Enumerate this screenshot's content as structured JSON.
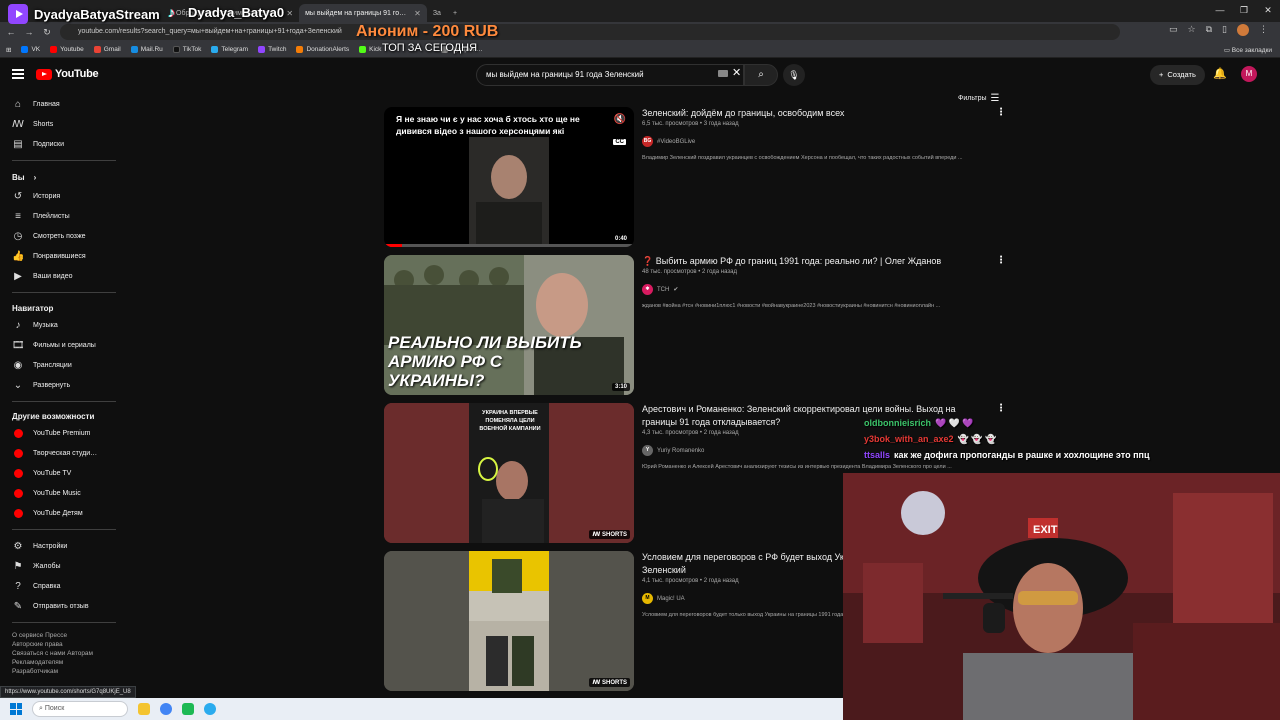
{
  "browser": {
    "tabs": [
      {
        "label": "Обращение Владимира Зеле…",
        "active": false
      },
      {
        "label": "мы выйдем на границы 91 го…",
        "active": true
      },
      {
        "label": "За",
        "active": false
      }
    ],
    "url": "youtube.com/results?search_query=мы+выйдем+на+границы+91+года+Зеленский",
    "bookmarks": [
      {
        "label": "VK",
        "color": "#0077ff"
      },
      {
        "label": "Youtube",
        "color": "#ff0000"
      },
      {
        "label": "Gmail",
        "color": "#ea4335"
      },
      {
        "label": "Mail.Ru",
        "color": "#168de2"
      },
      {
        "label": "TikTok",
        "color": "#111111"
      },
      {
        "label": "Telegram",
        "color": "#2aabee"
      },
      {
        "label": "Twitch",
        "color": "#9146ff"
      },
      {
        "label": "DonationAlerts",
        "color": "#f57d07"
      },
      {
        "label": "Kick",
        "color": "#53fc18"
      },
      {
        "label": "Аукцион…",
        "color": "#888888"
      }
    ],
    "all_bookmarks": "Все закладки",
    "status_url": "https://www.youtube.com/shorts/G7q8UKjE_U8"
  },
  "youtube": {
    "logo": "YouTube",
    "search_query": "мы выйдем на границы 91 года Зеленский",
    "create_label": "Создать",
    "avatar_letter": "M",
    "filters_label": "Фильтры"
  },
  "sidebar": {
    "main": [
      "Главная",
      "Shorts",
      "Подписки"
    ],
    "you_header": "Вы",
    "you": [
      "История",
      "Плейлисты",
      "Смотреть позже",
      "Понравившиеся",
      "Ваши видео"
    ],
    "nav_header": "Навигатор",
    "nav": [
      "Музыка",
      "Фильмы и сериалы",
      "Трансляции",
      "Развернуть"
    ],
    "more_header": "Другие возможности",
    "more": [
      "YouTube Premium",
      "Творческая студи…",
      "YouTube TV",
      "YouTube Music",
      "YouTube Детям"
    ],
    "settings": [
      "Настройки",
      "Жалобы",
      "Справка",
      "Отправить отзыв"
    ],
    "footer": [
      "О сервисе  Прессе",
      "Авторские права",
      "Связаться с нами  Авторам",
      "Рекламодателям",
      "Разработчикам"
    ]
  },
  "results": [
    {
      "title": "Зеленский: дойдём до границы, освободим всех",
      "meta": "6,5 тыс. просмотров • 3 года назад",
      "channel": "#VideoBGLive",
      "channel_icon_text": "BG",
      "channel_icon_color": "#c62828",
      "description": "Владимир Зеленский поздравил украинцев с освобождением Херсона и пообещал, что таких радостных событий впереди ...",
      "badge": "0:40",
      "subtitle_overlay": "Я не знаю чи є у нас хоча б хтось хто ще не дивився відео з нашого херсонцями які"
    },
    {
      "title": "Выбить армию РФ до границ 1991 года: реально ли? | Олег Жданов",
      "title_prefix": "❓",
      "meta": "48 тыс. просмотров • 2 года назад",
      "channel": "TCH",
      "channel_icon_text": "✱",
      "channel_icon_color": "#d81b60",
      "description": "жданов #война #тсн #новини1плюс1 #новости #войнавукраине2023 #новостиукраины #новинитсн #новиниonлайн ...",
      "badge": "3:10",
      "thumb_text": "РЕАЛЬНО ЛИ ВЫБИТЬ АРМИЮ РФ С УКРАИНЫ?"
    },
    {
      "title": "Арестович и Романенко: Зеленский скорректировал цели войны. Выход на границы 91 года откладывается?",
      "meta": "4,3 тыс. просмотров • 2 года назад",
      "channel": "Yuriy Romanenko",
      "channel_icon_text": "Y",
      "channel_icon_color": "#666666",
      "description": "Юрий Романенко и Алексей Арестович анализируют тезисы из интервью президента Владимира Зеленского про цели ...",
      "badge": "SHORTS",
      "thumb_text": "УКРАИНА ВПЕРВЫЕ ПОМЕНЯЛА ЦЕЛИ ВОЕННОЙ КАМПАНИИ"
    },
    {
      "title": "Условием для переговоров с РФ будет выход Украины на границы 1991 года – Зеленский",
      "meta": "4,1 тыс. просмотров • 2 года назад",
      "channel": "Magic! UA",
      "channel_icon_text": "M",
      "channel_icon_color": "#e6b800",
      "description": "Условием для переговоров будет только выход Украины на границы 1991 года...",
      "badge": "SHORTS"
    }
  ],
  "overlay": {
    "channel_name": "DyadyaBatyaStream",
    "tiktok_name": "Dyadya_Batya0",
    "donation": "Аноним - 200 RUB",
    "top_today": "ТОП ЗА СЕГОДНЯ",
    "chat": [
      {
        "user": "oldbonnieisrich",
        "color": "#3cc46a",
        "message": "💜 🤍 💜"
      },
      {
        "user": "y3bok_with_an_axe2",
        "color": "#e53935",
        "message": "👻 👻 👻"
      },
      {
        "user": "ttsalls",
        "color": "#9146ff",
        "message": "как же дофига пропоганды в рашке и хохлощине это ппц"
      }
    ]
  },
  "taskbar": {
    "search_placeholder": "Поиск"
  }
}
